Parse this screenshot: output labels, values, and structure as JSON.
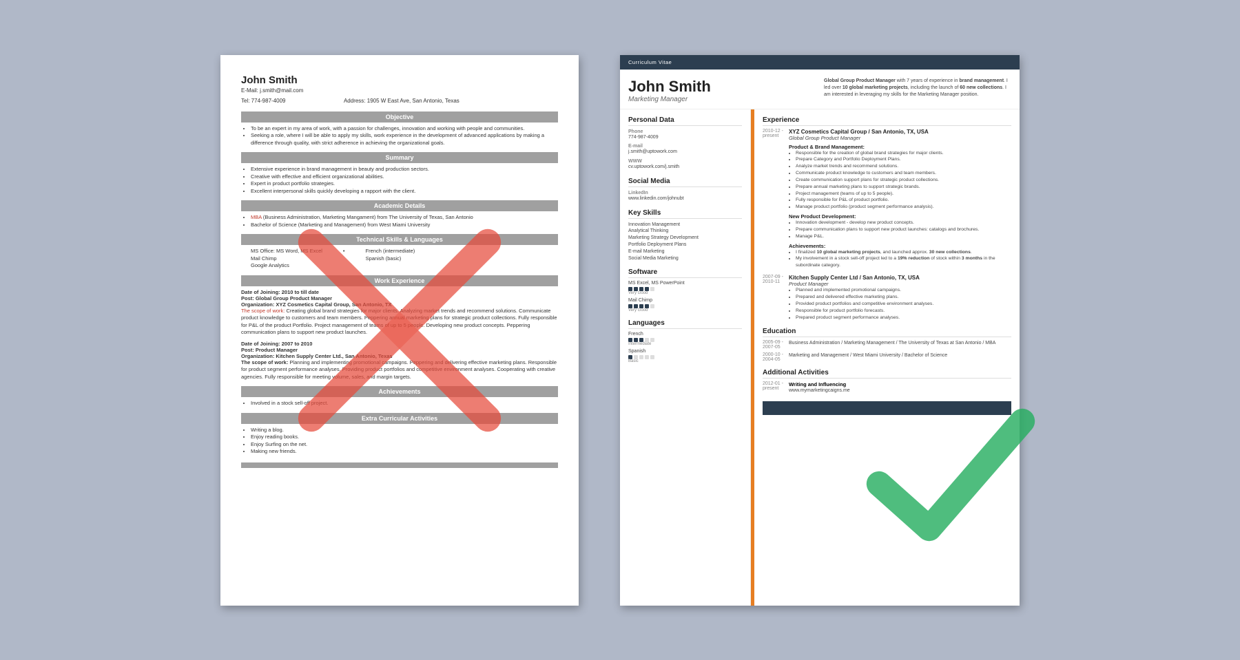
{
  "left_resume": {
    "name": "John Smith",
    "email": "E-Mail: j.smith@mail.com",
    "tel": "Tel: 774-987-4009",
    "address": "Address: 1905 W East Ave, San Antonio, Texas",
    "sections": {
      "objective": "Objective",
      "objective_bullets": [
        "To be an expert in my area of work, with a passion for challenges, innovation and working with people and communities.",
        "Seeking a role, where I will be able to apply my skills, work experience in the development of advanced applications by making a difference through quality, with strict adherence in achieving the organizational goals."
      ],
      "summary": "Summary",
      "summary_bullets": [
        "Extensive experience in brand management in beauty and production sectors.",
        "Creative with effective and efficient organizational abilities.",
        "Expert in product portfolio strategies.",
        "Excellent interpersonal skills quickly developing a rapport with the client."
      ],
      "academic": "Academic Details",
      "academic_bullets": [
        "MBA (Business Administration, Marketing Management) from The University of Texas, San Antonio",
        "Bachelor of Science (Marketing and Management) from West Miami University"
      ],
      "technical": "Technical Skills & Languages",
      "skills_left": [
        "MS Office: MS Word, MS Excel",
        "Mail Chimp",
        "Google Analytics"
      ],
      "skills_right": [
        "French (intermediate)",
        "Spanish (basic)"
      ],
      "work": "Work Experience",
      "work_entries": [
        {
          "date": "Date of Joining: 2010 to till date",
          "post": "Post: Global Group Product Manager",
          "org": "Organization: XYZ Cosmetics Capital Group, San Antonio, TX",
          "scope": "The scope of work: Creating global brand strategies for major clients. Analyzing market trends and recommend solutions. Communicate product knowledge to customers and team members. Peppering annual marketing plans for strategic product collections. Fully responsible for P&L of the product Portfolio. Project management of teams of up to 5 people. Developing new product concepts. Peppering communication plans to support new product launches."
        },
        {
          "date": "Date of Joining: 2007 to 2010",
          "post": "Post: Product Manager",
          "org": "Organization: Kitchen Supply Center Ltd., San Antonio, Texas",
          "scope": "The scope of work: Planning and implementing promotional campaigns. Peppering and delivering effective marketing plans. Responsible for product segment performance analyses. Providing product portfolios and competitive environment analyses. Cooperating with creative agencies. Fully responsible for meeting volume, sales, and margin targets."
        }
      ],
      "achievements": "Achievements",
      "achievements_bullets": [
        "Involved in a stock sell-off project."
      ],
      "extra": "Extra Curricular Activities",
      "extra_bullets": [
        "Writing a blog.",
        "Enjoy reading books.",
        "Enjoy Surfing on the net.",
        "Making new friends."
      ]
    }
  },
  "right_resume": {
    "banner": "Curriculum Vitae",
    "name": "John Smith",
    "title": "Marketing Manager",
    "summary": "Global Group Product Manager with 7 years of experience in brand management. I led over 10 global marketing projects, including the launch of 60 new collections. I am interested in leveraging my skills for the Marketing Manager position.",
    "personal_data": {
      "section": "Personal Data",
      "phone_label": "Phone",
      "phone": "774-987-4009",
      "email_label": "E-mail",
      "email": "j.smith@uptowork.com",
      "www_label": "WWW",
      "www": "cv.uptowork.com/j.smith"
    },
    "social_media": {
      "section": "Social Media",
      "linkedin_label": "LinkedIn",
      "linkedin": "www.linkedin.com/johnubt"
    },
    "key_skills": {
      "section": "Key Skills",
      "skills": [
        "Innovation Management",
        "Analytical Thinking",
        "Marketing Strategy Development",
        "Portfolio Deployment Plans",
        "E-mail Marketing",
        "Social Media Marketing"
      ]
    },
    "software": {
      "section": "Software",
      "items": [
        {
          "name": "MS Excel, MS PowerPoint",
          "level": 4,
          "max": 5,
          "label": "Very Good"
        },
        {
          "name": "Mail Chimp",
          "level": 4,
          "max": 5,
          "label": "Very Good"
        }
      ]
    },
    "languages": {
      "section": "Languages",
      "items": [
        {
          "name": "French",
          "level": 3,
          "max": 5,
          "label": "Intermediate"
        },
        {
          "name": "Spanish",
          "level": 1,
          "max": 5,
          "label": "Basic"
        }
      ]
    },
    "experience": {
      "section": "Experience",
      "entries": [
        {
          "dates": "2010-12 - present",
          "company": "XYZ Cosmetics Capital Group / San Antonio, TX, USA",
          "role": "Global Group Product Manager",
          "subsections": [
            {
              "label": "Product & Brand Management:",
              "bullets": [
                "Responsible for the creation of global brand strategies for major clients.",
                "Prepare Category and Portfolio Deployment Plans.",
                "Analyze market trends and recommend solutions.",
                "Communicate product knowledge to customers and team members.",
                "Create communication support plans for strategic product collections.",
                "Prepare annual marketing plans to support strategic brands.",
                "Project management (teams of up to 5 people).",
                "Fully responsible for P&L of product portfolio.",
                "Manage product portfolio (product segment performance analysis)."
              ]
            },
            {
              "label": "New Product Development:",
              "bullets": [
                "Innovation development - develop new product concepts.",
                "Prepare communication plans to support new product launches: catalogs and brochures.",
                "Manage P&L."
              ]
            },
            {
              "label": "Achievements:",
              "bullets": [
                "I finalized 10 global marketing projects, and launched approx. 30 new collections.",
                "My involvement in a stock sell-off project led to a 19% reduction of stock within 3 months in the subordinate category."
              ]
            }
          ]
        },
        {
          "dates": "2007-09 - 2010-11",
          "company": "Kitchen Supply Center Ltd / San Antonio, TX, USA",
          "role": "Product Manager",
          "subsections": [
            {
              "label": "",
              "bullets": [
                "Planned and implemented promotional campaigns.",
                "Prepared and delivered effective marketing plans.",
                "Provided product portfolios and competitive environment analyses.",
                "Responsible for product portfolio forecasts.",
                "Prepared product segment performance analyses."
              ]
            }
          ]
        }
      ]
    },
    "education": {
      "section": "Education",
      "entries": [
        {
          "dates": "2005-09 - 2007-05",
          "detail": "Business Administration / Marketing Management / The University of Texas at San Antonio / MBA"
        },
        {
          "dates": "2000-10 - 2004-05",
          "detail": "Marketing and Management / West Miami University / Bachelor of Science"
        }
      ]
    },
    "additional": {
      "section": "Additional Activities",
      "entries": [
        {
          "dates": "2012-01 - present",
          "label": "Writing and Influencing",
          "value": "www.mymarketingcaigns.me"
        }
      ]
    }
  }
}
